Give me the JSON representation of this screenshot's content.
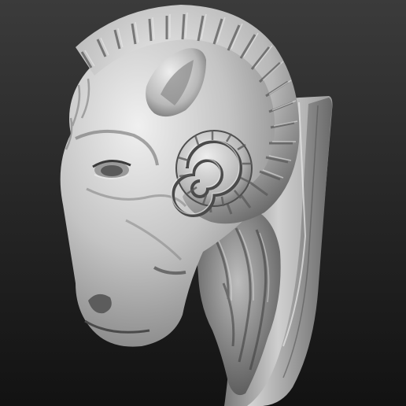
{
  "scene": {
    "subject": "ram-head-wall-mount-sculpt",
    "material": "matcap-gray-clay",
    "colors": {
      "background_top": "#3b3b3b",
      "background_bottom": "#121212",
      "clay_light": "#e4e4e4",
      "clay_mid": "#a6a6a6",
      "clay_dark": "#4a4a4a"
    }
  }
}
